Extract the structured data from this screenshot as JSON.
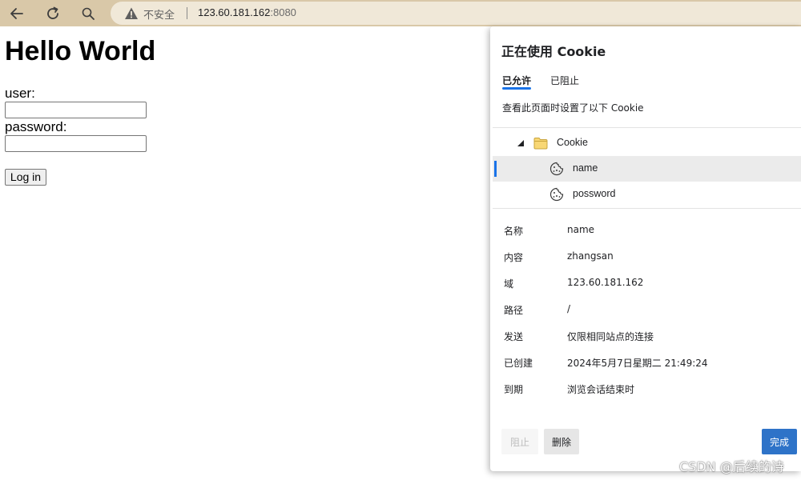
{
  "browser": {
    "back_icon": "back-arrow-icon",
    "reload_icon": "reload-icon",
    "search_icon": "search-icon",
    "security_label": "不安全",
    "url_host": "123.60.181.162",
    "url_port": ":8080"
  },
  "page": {
    "heading": "Hello World",
    "user_label": "user:",
    "password_label": "password:",
    "user_value": "",
    "password_value": "",
    "login_button": "Log in"
  },
  "cookie_panel": {
    "title": "正在使用 Cookie",
    "tabs": [
      {
        "label": "已允许",
        "active": true
      },
      {
        "label": "已阻止",
        "active": false
      }
    ],
    "description": "查看此页面时设置了以下 Cookie",
    "tree": {
      "folder": "Cookie",
      "items": [
        {
          "name": "name",
          "selected": true
        },
        {
          "name": "possword",
          "selected": false
        }
      ]
    },
    "details": [
      {
        "key": "名称",
        "value": "name"
      },
      {
        "key": "内容",
        "value": "zhangsan"
      },
      {
        "key": "域",
        "value": "123.60.181.162"
      },
      {
        "key": "路径",
        "value": "/"
      },
      {
        "key": "发送",
        "value": "仅限相同站点的连接"
      },
      {
        "key": "已创建",
        "value": "2024年5月7日星期二 21:49:24"
      },
      {
        "key": "到期",
        "value": "浏览会话结束时"
      }
    ],
    "buttons": {
      "block": "阻止",
      "delete": "删除",
      "done": "完成"
    }
  },
  "watermark": "CSDN @后续的诗",
  "colors": {
    "toolbar": "#d9c8a8",
    "address_bar": "#f0e8d8",
    "accent": "#1a73e8",
    "done_button": "#2e73c8"
  }
}
